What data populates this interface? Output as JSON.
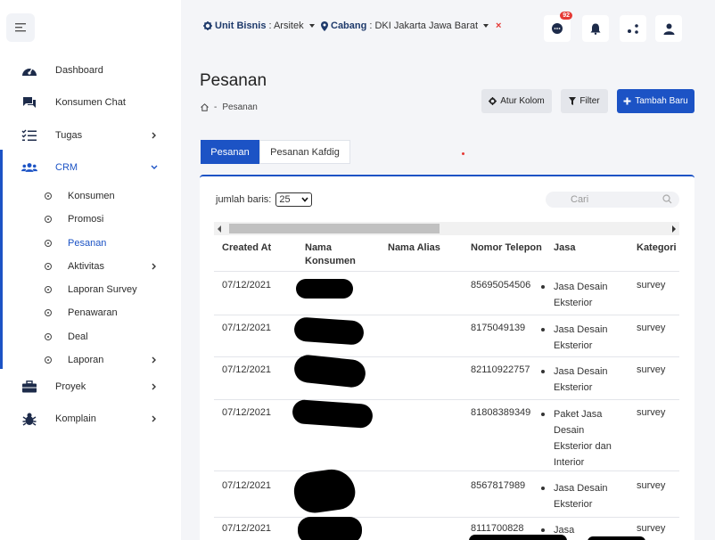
{
  "sidebar": {
    "items": [
      {
        "label": "Dashboard"
      },
      {
        "label": "Konsumen Chat"
      },
      {
        "label": "Tugas"
      },
      {
        "label": "CRM"
      },
      {
        "label": "Proyek"
      },
      {
        "label": "Komplain"
      }
    ],
    "crm_sub": [
      {
        "label": "Konsumen"
      },
      {
        "label": "Promosi"
      },
      {
        "label": "Pesanan"
      },
      {
        "label": "Aktivitas"
      },
      {
        "label": "Laporan Survey"
      },
      {
        "label": "Penawaran"
      },
      {
        "label": "Deal"
      },
      {
        "label": "Laporan"
      }
    ]
  },
  "topbar": {
    "unit_key": "Unit Bisnis",
    "unit_value": ": Arsitek",
    "cabang_key": "Cabang",
    "cabang_value": ": DKI Jakarta Jawa Barat",
    "clear": "×",
    "chat_badge": "92"
  },
  "page": {
    "title": "Pesanan",
    "breadcrumb_sep": "-",
    "breadcrumb_current": "Pesanan",
    "btn_columns": "Atur Kolom",
    "btn_filter": "Filter",
    "btn_add": "Tambah Baru"
  },
  "tabs": [
    {
      "label": "Pesanan"
    },
    {
      "label": "Pesanan Kafdig"
    }
  ],
  "table": {
    "rows_label": "jumlah baris:",
    "rows_value": "25",
    "search_placeholder": "Cari",
    "headers": {
      "created_at": "Created At",
      "nama_konsumen": "Nama Konsumen",
      "nama_alias": "Nama Alias",
      "telepon": "Nomor Telepon",
      "jasa": "Jasa",
      "kategori": "Kategori"
    },
    "rows": [
      {
        "date": "07/12/2021",
        "phone": "85695054506",
        "jasa": "Jasa Desain Eksterior",
        "kategori": "survey"
      },
      {
        "date": "07/12/2021",
        "phone": "8175049139",
        "jasa": "Jasa Desain Eksterior",
        "kategori": "survey"
      },
      {
        "date": "07/12/2021",
        "phone": "82110922757",
        "jasa": "Jasa Desain Eksterior",
        "kategori": "survey"
      },
      {
        "date": "07/12/2021",
        "phone": "81808389349",
        "jasa": "Paket Jasa Desain Eksterior dan Interior",
        "kategori": "survey"
      },
      {
        "date": "07/12/2021",
        "phone": "8567817989",
        "jasa": "Jasa Desain Eksterior",
        "kategori": "survey"
      },
      {
        "date": "07/12/2021",
        "phone": "8111700828",
        "jasa": "Jasa",
        "kategori": "survey"
      }
    ]
  },
  "colors": {
    "accent": "#1c53c5",
    "danger": "#e53935",
    "background": "#f4f5f8"
  }
}
